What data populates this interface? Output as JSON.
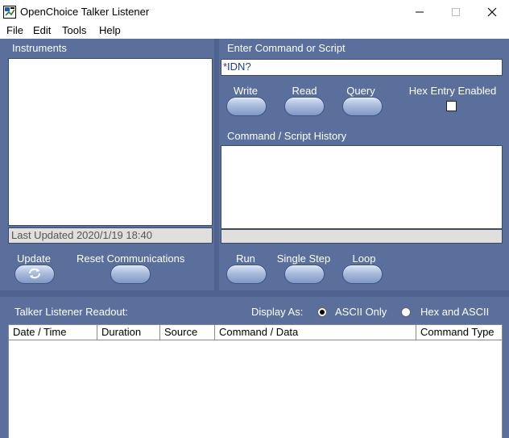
{
  "window": {
    "title": "OpenChoice Talker Listener",
    "icon": "app-icon",
    "controls": {
      "minimize": "—",
      "maximize": "☐",
      "close": "✕"
    }
  },
  "menu": [
    "File",
    "Edit",
    "Tools",
    "Help"
  ],
  "instruments": {
    "title": "Instruments",
    "last_updated": "Last Updated 2020/1/19 18:40",
    "update_label": "Update",
    "reset_label": "Reset Communications"
  },
  "command": {
    "title": "Enter Command or Script",
    "value": "*IDN?",
    "write_label": "Write",
    "read_label": "Read",
    "query_label": "Query",
    "hex_entry_label": "Hex Entry Enabled",
    "hex_entry_checked": false
  },
  "history": {
    "title": "Command / Script History",
    "run_label": "Run",
    "single_step_label": "Single Step",
    "loop_label": "Loop"
  },
  "readout": {
    "title": "Talker Listener Readout:",
    "display_as_label": "Display As:",
    "option_ascii": "ASCII Only",
    "option_hex": "Hex and ASCII",
    "selected": "ASCII Only",
    "columns": [
      "Date / Time",
      "Duration",
      "Source",
      "Command / Data",
      "Command Type"
    ]
  },
  "colors": {
    "panel_background": "#5a6f9b",
    "button_gradient_top": "#d7e2f4",
    "button_gradient_bottom": "#7f97c4",
    "command_text": "#1f3a93"
  }
}
